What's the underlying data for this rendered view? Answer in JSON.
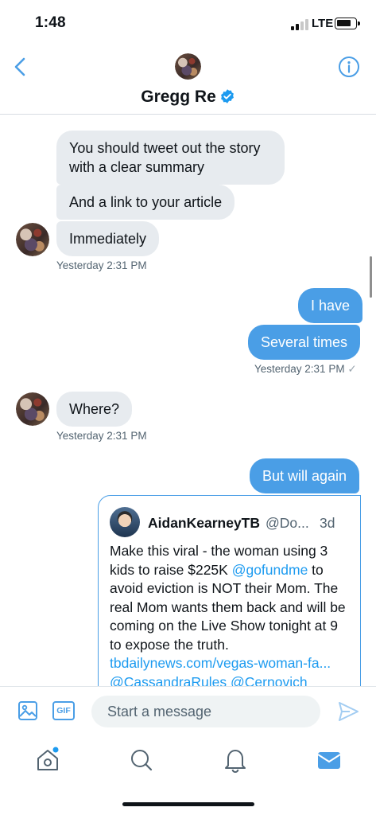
{
  "status_bar": {
    "time": "1:48",
    "network": "LTE"
  },
  "header": {
    "name": "Gregg Re"
  },
  "messages": {
    "m1": "You should tweet out the story with a clear summary",
    "m2": "And a link to your article",
    "m3": "Immediately",
    "t1": "Yesterday 2:31 PM",
    "m4": "I have",
    "m5": "Several times",
    "t2": "Yesterday 2:31 PM",
    "t2_check": "✓",
    "m6": "Where?",
    "t3": "Yesterday 2:31 PM",
    "m7": "But will again"
  },
  "quoted_tweet": {
    "name": "AidanKearneyTB",
    "handle": "@Do...",
    "age": "3d",
    "text_1": "Make this viral - the woman using 3 kids to raise $225K ",
    "mention_1": "@gofundme",
    "text_2": " to avoid eviction is NOT their Mom. The real Mom wants them back and will be coming on the Live Show tonight at 9 to expose the truth. ",
    "link": "tbdailynews.com/vegas-woman-fa...",
    "mention_2": "@CassandraRules",
    "mention_3": "@Cernovich"
  },
  "composer": {
    "placeholder": "Start a message",
    "gif_label": "GIF"
  },
  "colors": {
    "accent": "#4a9ee6",
    "incoming_bubble": "#e7ebef",
    "link": "#1d9bf0"
  },
  "icons": [
    "back-arrow-icon",
    "info-icon",
    "verified-badge-icon",
    "image-icon",
    "gif-icon",
    "send-icon",
    "home-icon",
    "search-icon",
    "bell-icon",
    "mail-icon"
  ]
}
